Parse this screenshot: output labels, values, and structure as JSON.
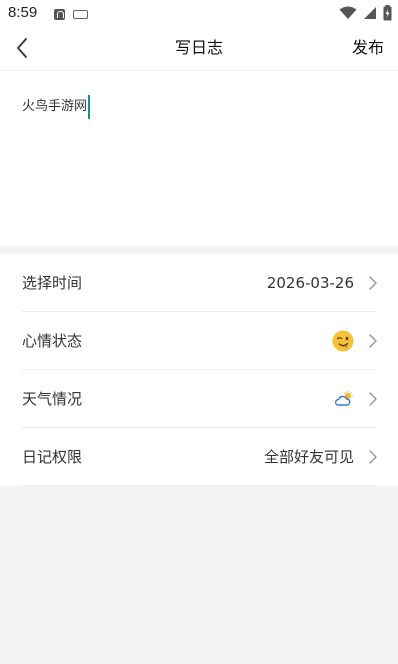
{
  "status_bar": {
    "time": "8:59"
  },
  "nav": {
    "title": "写日志",
    "publish_label": "发布"
  },
  "editor": {
    "text": "火鸟手游网"
  },
  "settings": {
    "rows": [
      {
        "label": "选择时间",
        "value": "2026-03-26",
        "value_type": "text"
      },
      {
        "label": "心情状态",
        "value_icon": "winking-face-icon",
        "value_type": "icon"
      },
      {
        "label": "天气情况",
        "value_icon": "partly-cloudy-icon",
        "value_type": "icon"
      },
      {
        "label": "日记权限",
        "value": "全部好友可见",
        "value_type": "text"
      }
    ]
  },
  "colors": {
    "caret": "#1a8f85",
    "background": "#f3f4f6",
    "surface": "#ffffff",
    "text": "#333333",
    "chevron": "#9a9a9a"
  }
}
